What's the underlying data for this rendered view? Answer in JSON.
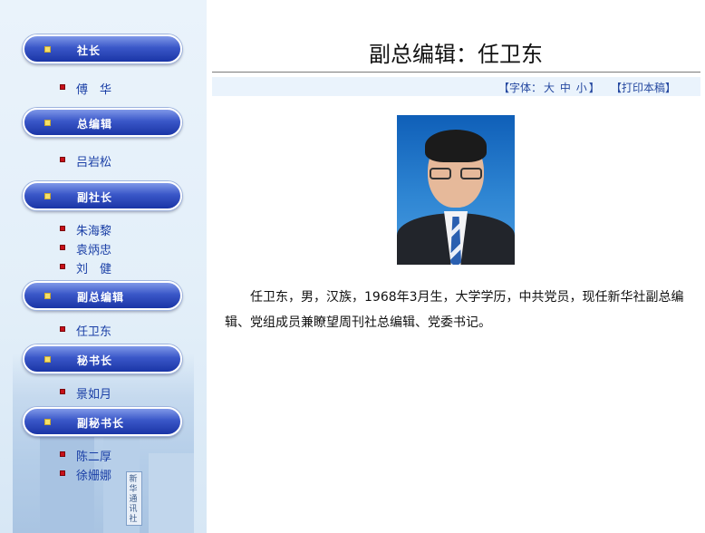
{
  "sidebar": {
    "sections": [
      {
        "header": "社长",
        "items": [
          "傅　华"
        ]
      },
      {
        "header": "总编辑",
        "items": [
          "吕岩松"
        ]
      },
      {
        "header": "副社长",
        "items": [
          "朱海黎",
          "袁炳忠",
          "刘　健"
        ]
      },
      {
        "header": "副总编辑",
        "items": [
          "任卫东"
        ]
      },
      {
        "header": "秘书长",
        "items": [
          "景如月"
        ]
      },
      {
        "header": "副秘书长",
        "items": [
          "陈二厚",
          "徐姗娜"
        ]
      }
    ],
    "building_sign": "新华通讯社"
  },
  "main": {
    "title": "副总编辑：任卫东",
    "toolbar": {
      "font_prefix": "【字体：",
      "font_large": "大",
      "font_medium": "中",
      "font_small": "小",
      "font_suffix": "】",
      "print_label": "【打印本稿】"
    },
    "bio": "任卫东，男，汉族，1968年3月生，大学学历，中共党员，现任新华社副总编辑、党组成员兼瞭望周刊社总编辑、党委书记。"
  },
  "colors": {
    "nav_blue": "#2a46bd",
    "link_blue": "#1a3fa6",
    "bullet_red": "#c8101a",
    "toolbar_bg": "#eaf3fc"
  }
}
